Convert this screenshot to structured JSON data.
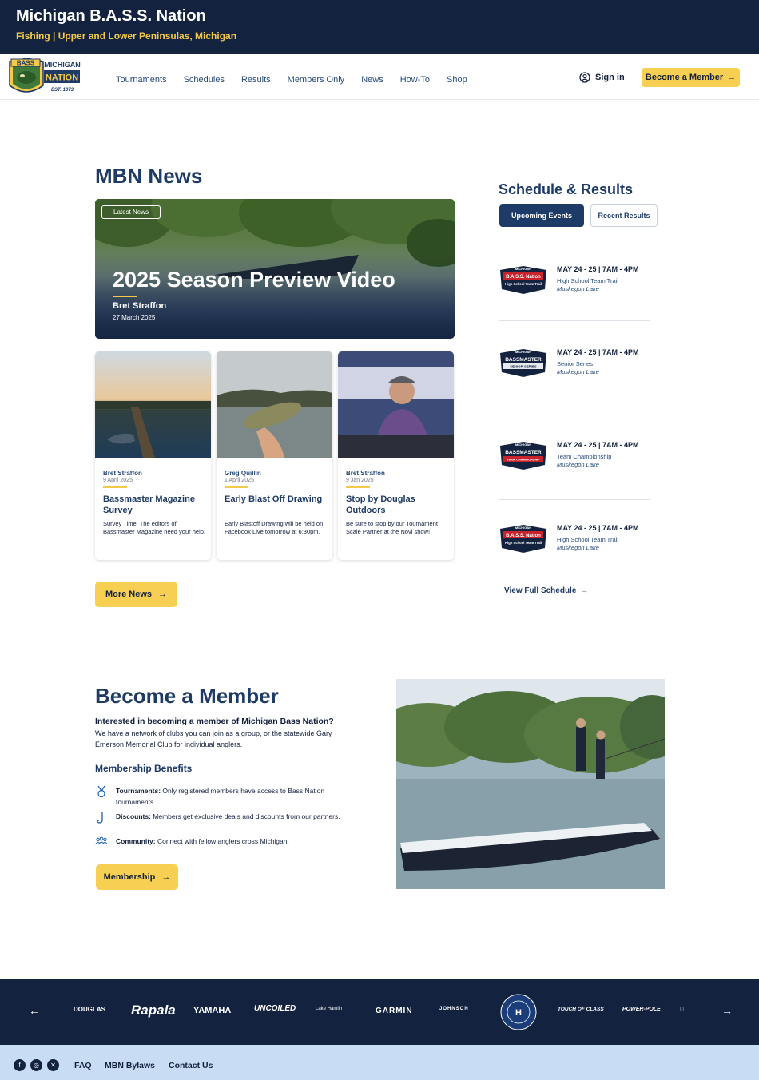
{
  "site": {
    "title": "Michigan B.A.S.S. Nation",
    "subtitle": "Fishing | Upper and Lower Peninsulas, Michigan"
  },
  "logo": {
    "line1": "MICHIGAN",
    "line2": "NATION",
    "bass": "BASS",
    "est": "EST. 1973"
  },
  "nav": {
    "items": [
      "Tournaments",
      "Schedules",
      "Results",
      "Members Only",
      "News",
      "How-To",
      "Shop"
    ],
    "signin": "Sign in",
    "become": "Become a Member"
  },
  "news": {
    "title": "MBN News",
    "hero": {
      "badge": "Latest News",
      "headline": "2025 Season Preview Video",
      "author": "Bret Straffon",
      "date": "27 March 2025"
    },
    "cards": [
      {
        "author": "Bret Straffon",
        "date": "9 April 2025",
        "title": "Bassmaster Magazine Survey",
        "desc": "Survey Time:  The editors of Bassmaster Magazine need your help."
      },
      {
        "author": "Greg Quillin",
        "date": "1 April 2025",
        "title": "Early Blast Off Drawing",
        "desc": "Early Blastoff Drawing will be held on Facebook Live tomorrow at 6:30pm."
      },
      {
        "author": "Bret Straffon",
        "date": "9 Jan 2025",
        "title": "Stop by Douglas Outdoors",
        "desc": "Be sure to stop by our Tournament Scale Partner at the Novi show!"
      }
    ],
    "more": "More News"
  },
  "schedule": {
    "title": "Schedule & Results",
    "tab_upcoming": "Upcoming Events",
    "tab_recent": "Recent Results",
    "events": [
      {
        "date": "MAY 24 - 25 | 7AM - 4PM",
        "name": "High School Team Trail",
        "location": "Muskegon Lake",
        "logo_top": "MICHIGAN",
        "logo_main": "B.A.S.S. Nation",
        "logo_sub": "High School Team Trail"
      },
      {
        "date": "MAY 24 - 25 | 7AM - 4PM",
        "name": "Senior Series",
        "location": "Muskegon Lake",
        "logo_top": "MICHIGAN",
        "logo_main": "BASSMASTER",
        "logo_sub": "SENIOR SERIES"
      },
      {
        "date": "MAY 24 - 25 | 7AM - 4PM",
        "name": "Team Championship",
        "location": "Muskegon Lake",
        "logo_top": "MICHIGAN",
        "logo_main": "BASSMASTER",
        "logo_sub": "TEAM CHAMPIONSHIP"
      },
      {
        "date": "MAY 24 - 25 | 7AM - 4PM",
        "name": "High School Team Trail",
        "location": "Muskegon Lake",
        "logo_top": "MICHIGAN",
        "logo_main": "B.A.S.S. Nation",
        "logo_sub": "High School Team Trail"
      }
    ],
    "view_full": "View Full Schedule"
  },
  "member": {
    "title": "Become a Member",
    "lead": "Interested in becoming a member of Michigan Bass Nation?",
    "text": "We have a network of clubs you can join as a group, or the statewide Gary Emerson Memorial Club for individual anglers.",
    "benefits_title": "Membership Benefits",
    "benefits": [
      {
        "label": "Tournaments:",
        "text": "Only registered members have access to Bass Nation tournaments."
      },
      {
        "label": "Discounts:",
        "text": "Members get exclusive deals and discounts from our partners."
      },
      {
        "label": "Community:",
        "text": "Connect with fellow anglers cross Michigan."
      }
    ],
    "button": "Membership"
  },
  "sponsors": [
    "DOUGLAS",
    "Rapala",
    "YAMAHA",
    "UNCOILED",
    "Lake Hamlin",
    "GARMIN",
    "JOHNSON",
    "TOUCH OF CLASS",
    "POWER-POLE",
    "III"
  ],
  "footer": {
    "links": [
      "FAQ",
      "MBN Bylaws",
      "Contact Us"
    ],
    "social": [
      "facebook-icon",
      "instagram-icon",
      "x-icon"
    ]
  },
  "colors": {
    "navy": "#13233f",
    "accent": "#f7cf53",
    "heading": "#1e3a66",
    "footer_bg": "#c8ddf3"
  }
}
